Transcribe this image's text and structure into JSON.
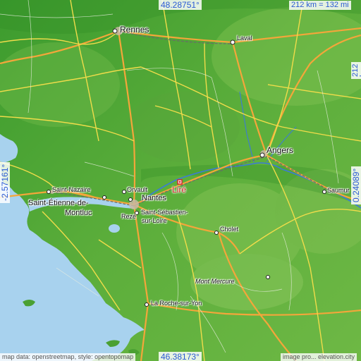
{
  "map": {
    "coords": {
      "top": "48.28751°",
      "bottom": "46.38173°",
      "left": "-2.57161°",
      "right": "0.24089°"
    },
    "scale_label": "212 km = 132 mi",
    "credits": {
      "left": "map data: openstreetmap, style: opentopomap",
      "right": "image pro... elevation.city"
    },
    "marker": {
      "label": "Liré",
      "color": "#d8282e"
    },
    "cities": {
      "rennes": "Rennes",
      "laval": "Laval",
      "angers": "Angers",
      "saumur": "Saumur",
      "cholet": "Cholet",
      "nantes": "Nantes",
      "orvault": "Orvault",
      "reze": "Rezé",
      "saint_nazaire": "Saint-Nazaire",
      "saint_etienne_1": "Saint-Étienne-de-",
      "saint_etienne_2": "Montluc",
      "saint_sebastien_1": "Saint-Sébastien-",
      "saint_sebastien_2": "sur-Loire",
      "la_roche": "La Roche-sur-Yon",
      "mont_mercure": "Mont Mercure"
    },
    "colors": {
      "sea": "#a8d2ee",
      "land": "#58a838",
      "river": "#3c7ad8",
      "coord_text": "#2a5ad4"
    }
  }
}
